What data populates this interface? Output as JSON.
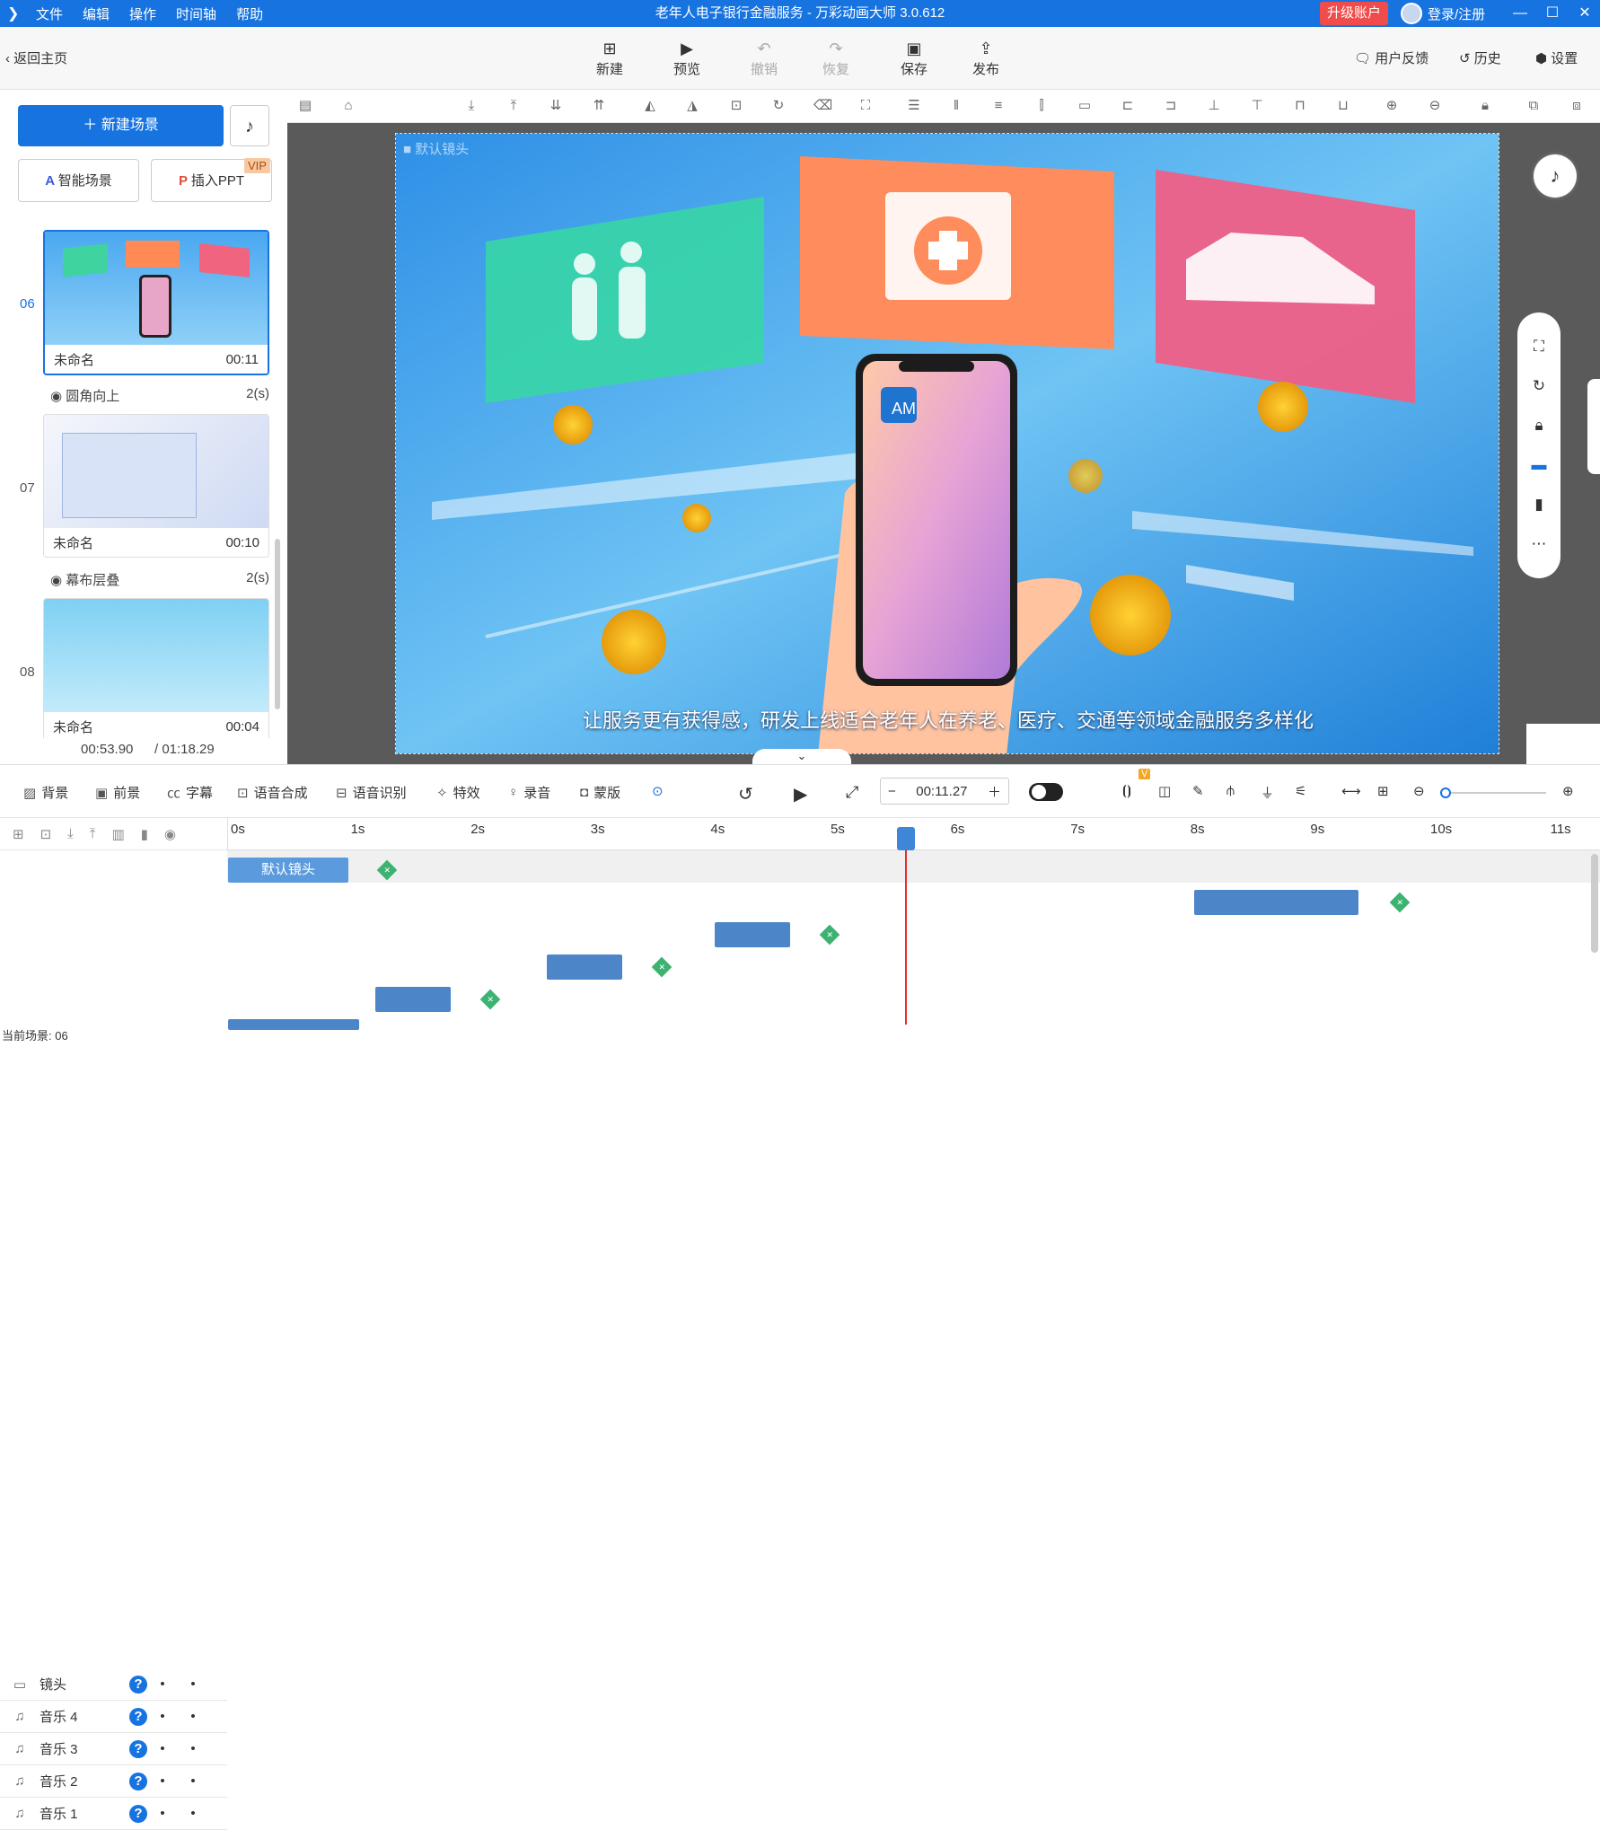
{
  "window": {
    "title": "老年人电子银行金融服务 - 万彩动画大师 3.0.612",
    "menu": [
      "文件",
      "编辑",
      "操作",
      "时间轴",
      "帮助"
    ],
    "upgrade": "升级账户",
    "login": "登录/注册"
  },
  "topbar": {
    "back": "返回主页",
    "buttons": [
      "新建",
      "预览",
      "撤销",
      "恢复",
      "保存",
      "发布"
    ],
    "right": [
      "用户反馈",
      "历史",
      "设置"
    ]
  },
  "sidebar": {
    "new_scene": "新建场景",
    "smart_scene": "智能场景",
    "insert_ppt": "插入PPT",
    "vip": "VIP",
    "scenes": [
      {
        "num": "06",
        "name": "未命名",
        "duration": "00:11",
        "transition": "圆角向上",
        "trans_time": "2(s)"
      },
      {
        "num": "07",
        "name": "未命名",
        "duration": "00:10",
        "transition": "幕布层叠",
        "trans_time": "2(s)"
      },
      {
        "num": "08",
        "name": "未命名",
        "duration": "00:04"
      }
    ],
    "current_time": "00:53.90",
    "total_time": "/ 01:18.29"
  },
  "stage": {
    "camera_label": "默认镜头",
    "subtitle": "让服务更有获得感，研发上线适合老年人在养老、医疗、交通等领域金融服务多样化",
    "app_label": "AM"
  },
  "bottombar": {
    "items": [
      "背景",
      "前景",
      "字幕",
      "语音合成",
      "语音识别",
      "特效",
      "录音",
      "蒙版"
    ],
    "time": "00:11.27",
    "vbadge": "V"
  },
  "timeline": {
    "ticks": [
      "0s",
      "1s",
      "2s",
      "3s",
      "4s",
      "5s",
      "6s",
      "7s",
      "8s",
      "9s",
      "10s",
      "11s"
    ],
    "playhead_seconds": 5.6,
    "tracks": [
      {
        "name": "镜头",
        "clip_label": "默认镜头"
      },
      {
        "name": "音乐 4"
      },
      {
        "name": "音乐 3"
      },
      {
        "name": "音乐 2"
      },
      {
        "name": "音乐 1"
      }
    ],
    "current_scene": "当前场景: 06"
  }
}
